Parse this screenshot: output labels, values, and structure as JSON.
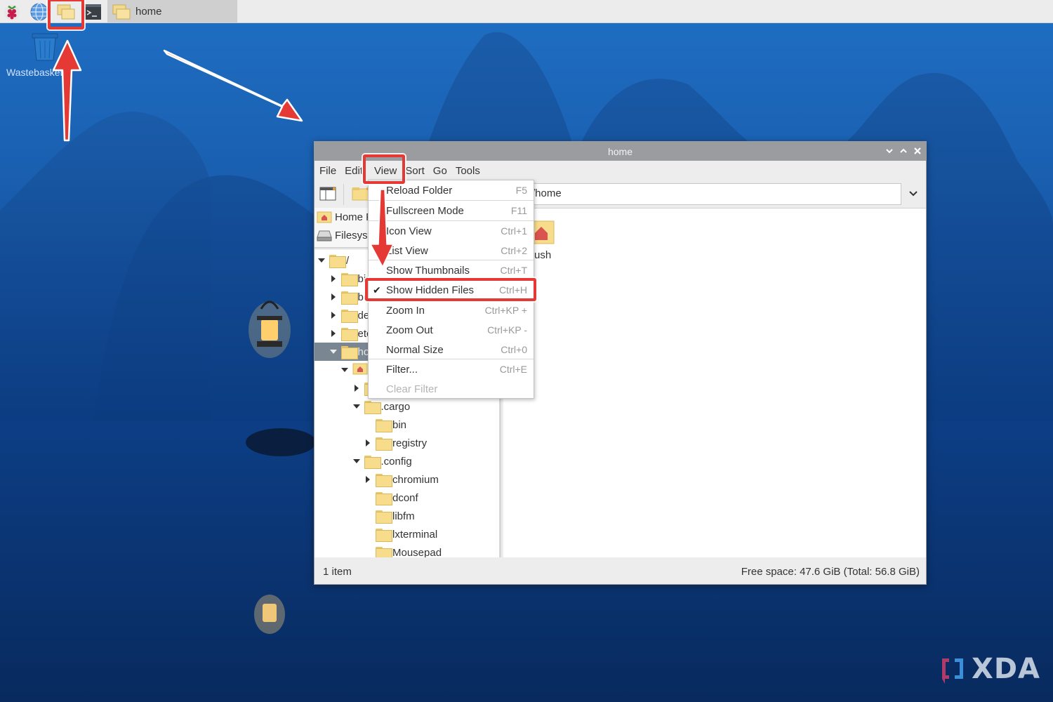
{
  "taskbar": {
    "icons": [
      {
        "name": "raspberry-pi-menu-icon"
      },
      {
        "name": "web-browser-icon"
      },
      {
        "name": "file-manager-icon"
      },
      {
        "name": "terminal-icon"
      }
    ],
    "task": {
      "label": "home"
    }
  },
  "desktop": {
    "icons": [
      {
        "label": "Wastebasket"
      }
    ]
  },
  "window": {
    "title": "home",
    "menu": [
      "File",
      "Edit",
      "View",
      "Sort",
      "Go",
      "Tools"
    ],
    "path": "/home",
    "places": [
      {
        "label": "Home Folder",
        "icon": "home-folder-icon"
      },
      {
        "label": "Filesystem Root",
        "icon": "drive-icon"
      }
    ],
    "tree": [
      {
        "label": "/",
        "depth": 0,
        "state": "expanded"
      },
      {
        "label": "bin",
        "depth": 1,
        "state": "collapsed"
      },
      {
        "label": "boot",
        "depth": 1,
        "state": "collapsed"
      },
      {
        "label": "dev",
        "depth": 1,
        "state": "collapsed"
      },
      {
        "label": "etc",
        "depth": 1,
        "state": "collapsed"
      },
      {
        "label": "home",
        "depth": 1,
        "state": "expanded",
        "selected": true
      },
      {
        "label": "",
        "depth": 2,
        "state": "expanded",
        "home": true
      },
      {
        "label": "",
        "depth": 3,
        "state": "collapsed"
      },
      {
        "label": ".cargo",
        "depth": 3,
        "state": "expanded"
      },
      {
        "label": "bin",
        "depth": 4,
        "state": "none"
      },
      {
        "label": "registry",
        "depth": 4,
        "state": "collapsed"
      },
      {
        "label": ".config",
        "depth": 3,
        "state": "expanded"
      },
      {
        "label": "chromium",
        "depth": 4,
        "state": "collapsed"
      },
      {
        "label": "dconf",
        "depth": 4,
        "state": "none"
      },
      {
        "label": "libfm",
        "depth": 4,
        "state": "none"
      },
      {
        "label": "lxterminal",
        "depth": 4,
        "state": "none"
      },
      {
        "label": "Mousepad",
        "depth": 4,
        "state": "none"
      }
    ],
    "files": [
      {
        "label": "ush",
        "icon": "home-folder-icon"
      }
    ],
    "status": {
      "items": "1 item",
      "free_space": "Free space: 47.6 GiB (Total: 56.8 GiB)"
    }
  },
  "view_menu": {
    "items": [
      {
        "label": "Reload Folder",
        "shortcut": "F5"
      },
      {
        "label": "Fullscreen Mode",
        "shortcut": "F11"
      },
      {
        "label": "Icon View",
        "shortcut": "Ctrl+1"
      },
      {
        "label": "List View",
        "shortcut": "Ctrl+2"
      },
      {
        "label": "Show Thumbnails",
        "shortcut": "Ctrl+T"
      },
      {
        "label": "Show Hidden Files",
        "shortcut": "Ctrl+H",
        "checked": true
      },
      {
        "label": "Zoom In",
        "shortcut": "Ctrl+KP +"
      },
      {
        "label": "Zoom Out",
        "shortcut": "Ctrl+KP -"
      },
      {
        "label": "Normal Size",
        "shortcut": "Ctrl+0"
      },
      {
        "label": "Filter...",
        "shortcut": "Ctrl+E"
      },
      {
        "label": "Clear Filter",
        "shortcut": "",
        "disabled": true
      }
    ]
  },
  "watermark": {
    "label": "XDA"
  },
  "colors": {
    "annotation": "#e53935",
    "titlebar": "#9a9c9f",
    "selection": "#7b8693",
    "folder": "#f7dc8b"
  }
}
